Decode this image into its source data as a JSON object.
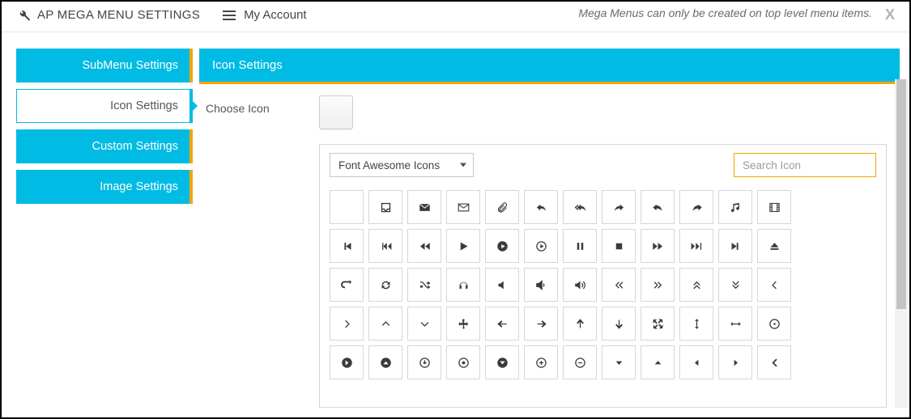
{
  "header": {
    "title": "AP MEGA MENU SETTINGS",
    "account_label": "My Account",
    "note": "Mega Menus can only be created on top level menu items."
  },
  "sidebar": {
    "items": [
      {
        "label": "SubMenu Settings",
        "active": false
      },
      {
        "label": "Icon Settings",
        "active": true
      },
      {
        "label": "Custom Settings",
        "active": false
      },
      {
        "label": "Image Settings",
        "active": false
      }
    ]
  },
  "panel": {
    "title": "Icon Settings",
    "choose_label": "Choose Icon",
    "library_select": "Font Awesome Icons",
    "search_placeholder": "Search Icon"
  },
  "icons": [
    "blank",
    "inbox",
    "envelope-solid",
    "envelope-outline",
    "paperclip",
    "reply",
    "reply-all",
    "share",
    "undo",
    "redo",
    "music",
    "film",
    "step-backward",
    "fast-backward",
    "backward",
    "play",
    "circle-play-solid",
    "circle-play-outline",
    "pause",
    "stop",
    "forward",
    "fast-forward",
    "step-forward",
    "eject",
    "repeat",
    "refresh",
    "random",
    "headphones",
    "volume-off",
    "volume-down",
    "volume-up",
    "angle-double-left",
    "angle-double-right",
    "angle-double-up",
    "angle-double-down",
    "angle-left",
    "angle-right",
    "angle-up",
    "angle-down",
    "move",
    "arrow-left",
    "arrow-right",
    "arrow-up",
    "arrow-down",
    "expand",
    "resize-vertical",
    "resize-horizontal",
    "crosshair",
    "circle-arrow-right",
    "circle-arrow-up",
    "circle-arrow-down-variant",
    "circle-dot",
    "circle-arrow-down",
    "circle-plus-outline",
    "circle-minus-outline",
    "caret-down",
    "caret-up",
    "caret-left",
    "caret-right",
    "chevron-left"
  ],
  "icon_glyphs": {
    "blank": "",
    "inbox": "inbox",
    "envelope-solid": "env-s",
    "envelope-outline": "env-o",
    "paperclip": "clip",
    "reply": "reply",
    "reply-all": "reply-all",
    "share": "share",
    "undo": "undo",
    "redo": "redo",
    "music": "music",
    "film": "film",
    "step-backward": "step-bwd",
    "fast-backward": "fast-bwd",
    "backward": "bwd",
    "play": "play",
    "circle-play-solid": "cplay-s",
    "circle-play-outline": "cplay-o",
    "pause": "pause",
    "stop": "stop",
    "forward": "fwd",
    "fast-forward": "fast-fwd",
    "step-forward": "step-fwd",
    "eject": "eject",
    "repeat": "repeat",
    "refresh": "refresh",
    "random": "random",
    "headphones": "head",
    "volume-off": "vol-off",
    "volume-down": "vol-dn",
    "volume-up": "vol-up",
    "angle-double-left": "dbl-l",
    "angle-double-right": "dbl-r",
    "angle-double-up": "dbl-u",
    "angle-double-down": "dbl-d",
    "angle-left": "ang-l",
    "angle-right": "ang-r",
    "angle-up": "ang-u",
    "angle-down": "ang-d",
    "move": "move",
    "arrow-left": "arr-l",
    "arrow-right": "arr-r",
    "arrow-up": "arr-u",
    "arrow-down": "arr-d",
    "expand": "expand",
    "resize-vertical": "res-v",
    "resize-horizontal": "res-h",
    "crosshair": "cross",
    "circle-arrow-right": "c-arr-r",
    "circle-arrow-up": "c-arr-u",
    "circle-arrow-down-variant": "c-arr-dv",
    "circle-dot": "c-dot",
    "circle-arrow-down": "c-arr-d",
    "circle-plus-outline": "c-plus",
    "circle-minus-outline": "c-minus",
    "caret-down": "car-d",
    "caret-up": "car-u",
    "caret-left": "car-l",
    "caret-right": "car-r",
    "chevron-left": "chev-l"
  }
}
